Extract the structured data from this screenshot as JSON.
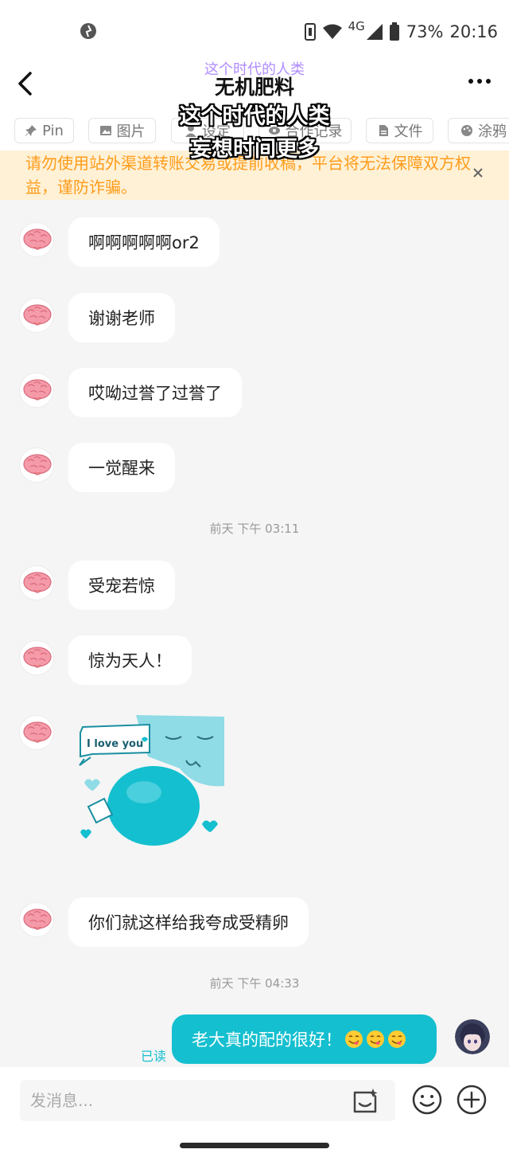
{
  "status_bar": {
    "network": "4G",
    "battery": "73%",
    "time": "20:16"
  },
  "header": {
    "subtitle": "这个时代的人类",
    "title": "无机肥料"
  },
  "overlay_caption": {
    "line1": "这个时代的人类",
    "line2": "妄想时间更多"
  },
  "toolbar": {
    "pin": "Pin",
    "images": "图片",
    "settings": "设定",
    "history": "合作记录",
    "files": "文件",
    "doodle": "涂鸦"
  },
  "notice": {
    "text": "请勿使用站外渠道转账交易或提前收稿，平台将无法保障双方权益，谨防诈骗。"
  },
  "messages": {
    "m1": "啊啊啊啊啊or2",
    "m2": "谢谢老师",
    "m3": "哎呦过誉了过誉了",
    "m4": "一觉醒来",
    "t1": "前天 下午 03:11",
    "m5": "受宠若惊",
    "m6": "惊为天人！",
    "sticker_text": "I love you",
    "m7": "你们就这样给我夸成受精卵",
    "t2": "前天 下午 04:33",
    "mine": "老大真的配的很好！",
    "read_status": "已读"
  },
  "input": {
    "placeholder": "发消息..."
  },
  "colors": {
    "accent": "#14bfcf",
    "notice_bg": "#fff1d6",
    "notice_text": "#ff9c1a",
    "subtitle": "#b08cff"
  }
}
